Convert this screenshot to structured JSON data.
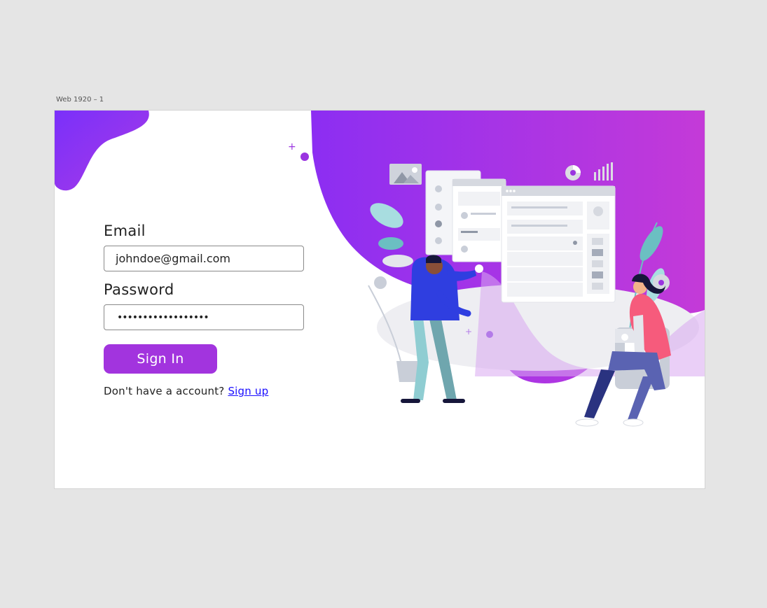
{
  "artboard": {
    "label": "Web 1920 – 1"
  },
  "login": {
    "email_label": "Email",
    "email_value": "johndoe@gmail.com",
    "password_label": "Password",
    "password_value": "••••••••••••••••••",
    "signin_label": "Sign In",
    "signup_prompt": "Don't have a account?",
    "signup_link": "Sign up"
  },
  "colors": {
    "brand_purple": "#a234de",
    "gradient_start": "#7b2ff7",
    "gradient_end": "#c43ad8",
    "link": "#1a0dff"
  }
}
